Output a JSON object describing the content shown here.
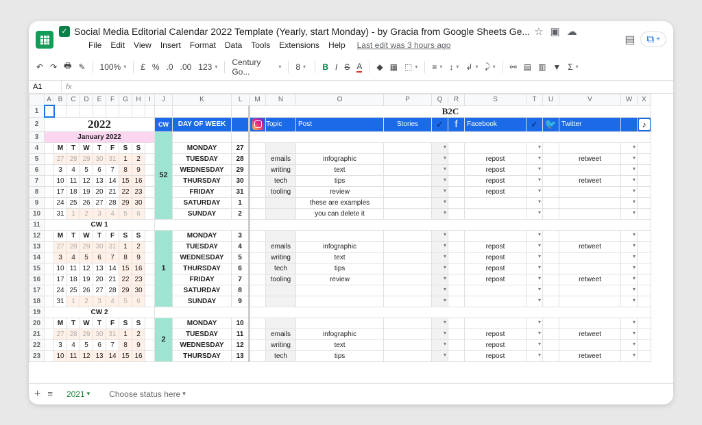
{
  "title": "Social Media Editorial Calendar 2022 Template (Yearly, start Monday) - by Gracia from Google Sheets Ge...",
  "menu": {
    "file": "File",
    "edit": "Edit",
    "view": "View",
    "insert": "Insert",
    "format": "Format",
    "data": "Data",
    "tools": "Tools",
    "extensions": "Extensions",
    "help": "Help",
    "last_edit": "Last edit was 3 hours ago"
  },
  "toolbar": {
    "zoom": "100%",
    "currency": "£",
    "pct": "%",
    "dec0": ".0",
    "dec00": ".00",
    "num": "123",
    "font": "Century Go...",
    "size": "8"
  },
  "namebox": "A1",
  "columns": [
    "",
    "A",
    "B",
    "C",
    "D",
    "E",
    "F",
    "G",
    "H",
    "I",
    "J",
    "K",
    "L",
    "M",
    "N",
    "O",
    "P",
    "Q",
    "R",
    "S",
    "T",
    "U",
    "V",
    "W",
    "X"
  ],
  "row_count": 23,
  "year": "2022",
  "b2c": "B2C",
  "headers": {
    "cw": "CW",
    "dow": "DAY OF WEEK",
    "topic": "Topic",
    "post": "Post",
    "stories": "Stories",
    "facebook": "Facebook",
    "twitter": "Twitter"
  },
  "month": "January 2022",
  "day_short": [
    "M",
    "T",
    "W",
    "T",
    "F",
    "S",
    "S"
  ],
  "cw_labels": {
    "cw1": "CW 1",
    "cw2": "CW 2"
  },
  "minical1": [
    [
      27,
      28,
      29,
      30,
      31,
      1,
      2
    ],
    [
      3,
      4,
      5,
      6,
      7,
      8,
      9
    ],
    [
      10,
      11,
      12,
      13,
      14,
      15,
      16
    ],
    [
      17,
      18,
      19,
      20,
      21,
      22,
      23
    ],
    [
      24,
      25,
      26,
      27,
      28,
      29,
      30
    ],
    [
      31,
      1,
      2,
      3,
      4,
      5,
      6
    ]
  ],
  "minical2": [
    [
      27,
      28,
      29,
      30,
      31,
      1,
      2
    ],
    [
      3,
      4,
      5,
      6,
      7,
      8,
      9
    ],
    [
      10,
      11,
      12,
      13,
      14,
      15,
      16
    ],
    [
      17,
      18,
      19,
      20,
      21,
      22,
      23
    ],
    [
      24,
      25,
      26,
      27,
      28,
      29,
      30
    ],
    [
      31,
      1,
      2,
      3,
      4,
      5,
      6
    ]
  ],
  "minical3": [
    [
      27,
      28,
      29,
      30,
      31,
      1,
      2
    ],
    [
      10,
      11,
      12,
      13,
      14,
      15,
      16
    ]
  ],
  "weeks": [
    {
      "cw": "52",
      "rows": [
        {
          "day": "MONDAY",
          "date": "27",
          "topic": "",
          "post": "",
          "fb": "",
          "tw": ""
        },
        {
          "day": "TUESDAY",
          "date": "28",
          "topic": "emails",
          "post": "infographic",
          "fb": "repost",
          "tw": "retweet"
        },
        {
          "day": "WEDNESDAY",
          "date": "29",
          "topic": "writing",
          "post": "text",
          "fb": "repost",
          "tw": ""
        },
        {
          "day": "THURSDAY",
          "date": "30",
          "topic": "tech",
          "post": "tips",
          "fb": "repost",
          "tw": "retweet"
        },
        {
          "day": "FRIDAY",
          "date": "31",
          "topic": "tooling",
          "post": "review",
          "fb": "repost",
          "tw": ""
        },
        {
          "day": "SATURDAY",
          "date": "1",
          "topic": "",
          "post": "these are examples",
          "fb": "",
          "tw": ""
        },
        {
          "day": "SUNDAY",
          "date": "2",
          "topic": "",
          "post": "you can delete it",
          "fb": "",
          "tw": ""
        }
      ]
    },
    {
      "cw": "1",
      "rows": [
        {
          "day": "MONDAY",
          "date": "3",
          "topic": "",
          "post": "",
          "fb": "",
          "tw": ""
        },
        {
          "day": "TUESDAY",
          "date": "4",
          "topic": "emails",
          "post": "infographic",
          "fb": "repost",
          "tw": "retweet"
        },
        {
          "day": "WEDNESDAY",
          "date": "5",
          "topic": "writing",
          "post": "text",
          "fb": "repost",
          "tw": ""
        },
        {
          "day": "THURSDAY",
          "date": "6",
          "topic": "tech",
          "post": "tips",
          "fb": "repost",
          "tw": ""
        },
        {
          "day": "FRIDAY",
          "date": "7",
          "topic": "tooling",
          "post": "review",
          "fb": "repost",
          "tw": "retweet"
        },
        {
          "day": "SATURDAY",
          "date": "8",
          "topic": "",
          "post": "",
          "fb": "",
          "tw": ""
        },
        {
          "day": "SUNDAY",
          "date": "9",
          "topic": "",
          "post": "",
          "fb": "",
          "tw": ""
        }
      ]
    },
    {
      "cw": "2",
      "rows": [
        {
          "day": "MONDAY",
          "date": "10",
          "topic": "",
          "post": "",
          "fb": "",
          "tw": ""
        },
        {
          "day": "TUESDAY",
          "date": "11",
          "topic": "emails",
          "post": "infographic",
          "fb": "repost",
          "tw": "retweet"
        },
        {
          "day": "WEDNESDAY",
          "date": "12",
          "topic": "writing",
          "post": "text",
          "fb": "repost",
          "tw": ""
        },
        {
          "day": "THURSDAY",
          "date": "13",
          "topic": "tech",
          "post": "tips",
          "fb": "repost",
          "tw": "retweet"
        }
      ]
    }
  ],
  "bottom": {
    "tab": "2021",
    "status": "Choose status here"
  }
}
